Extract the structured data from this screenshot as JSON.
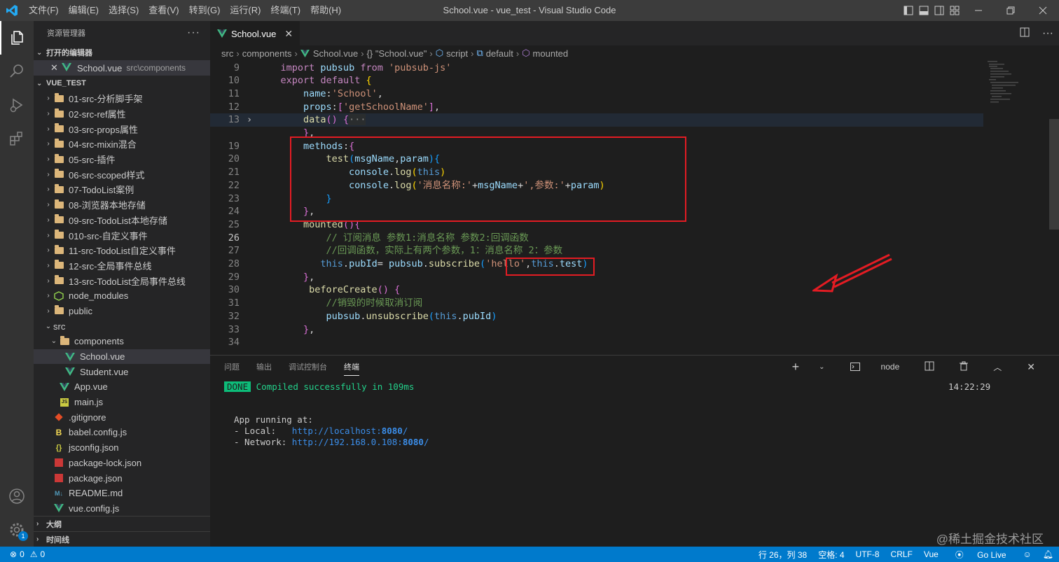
{
  "titlebar": {
    "menu": [
      "文件(F)",
      "编辑(E)",
      "选择(S)",
      "查看(V)",
      "转到(G)",
      "运行(R)",
      "终端(T)",
      "帮助(H)"
    ],
    "window_title": "School.vue - vue_test - Visual Studio Code"
  },
  "sidebar": {
    "header": "资源管理器",
    "open_editors_label": "打开的编辑器",
    "open_editor": {
      "name": "School.vue",
      "path": "src\\components"
    },
    "project_label": "VUE_TEST",
    "tree": [
      {
        "label": "01-src-分析脚手架",
        "type": "folder",
        "depth": 1
      },
      {
        "label": "02-src-ref属性",
        "type": "folder",
        "depth": 1
      },
      {
        "label": "03-src-props属性",
        "type": "folder",
        "depth": 1
      },
      {
        "label": "04-src-mixin混合",
        "type": "folder",
        "depth": 1
      },
      {
        "label": "05-src-插件",
        "type": "folder",
        "depth": 1
      },
      {
        "label": "06-src-scoped样式",
        "type": "folder",
        "depth": 1
      },
      {
        "label": "07-TodoList案例",
        "type": "folder",
        "depth": 1
      },
      {
        "label": "08-浏览器本地存储",
        "type": "folder",
        "depth": 1
      },
      {
        "label": "09-src-TodoList本地存储",
        "type": "folder",
        "depth": 1
      },
      {
        "label": "010-src-自定义事件",
        "type": "folder",
        "depth": 1
      },
      {
        "label": "11-src-TodoList自定义事件",
        "type": "folder",
        "depth": 1
      },
      {
        "label": "12-src-全局事件总线",
        "type": "folder",
        "depth": 1
      },
      {
        "label": "13-src-TodoList全局事件总线",
        "type": "folder",
        "depth": 1
      },
      {
        "label": "node_modules",
        "type": "node",
        "depth": 1
      },
      {
        "label": "public",
        "type": "folder",
        "depth": 1
      },
      {
        "label": "src",
        "type": "open",
        "depth": 1
      },
      {
        "label": "components",
        "type": "openfolder",
        "depth": 2
      },
      {
        "label": "School.vue",
        "type": "vue",
        "depth": 3,
        "selected": true
      },
      {
        "label": "Student.vue",
        "type": "vue",
        "depth": 3
      },
      {
        "label": "App.vue",
        "type": "vue",
        "depth": 2
      },
      {
        "label": "main.js",
        "type": "js",
        "depth": 2
      },
      {
        "label": ".gitignore",
        "type": "git",
        "depth": 1
      },
      {
        "label": "babel.config.js",
        "type": "babel",
        "depth": 1
      },
      {
        "label": "jsconfig.json",
        "type": "json",
        "depth": 1
      },
      {
        "label": "package-lock.json",
        "type": "npm",
        "depth": 1
      },
      {
        "label": "package.json",
        "type": "npm",
        "depth": 1
      },
      {
        "label": "README.md",
        "type": "md",
        "depth": 1
      },
      {
        "label": "vue.config.js",
        "type": "vue",
        "depth": 1
      }
    ],
    "outline_label": "大纲",
    "timeline_label": "时间线"
  },
  "activity": {
    "settings_badge": "1"
  },
  "editor": {
    "tab": "School.vue",
    "breadcrumbs": [
      "src",
      "components",
      "School.vue",
      "{} \"School.vue\"",
      "script",
      "default",
      "mounted"
    ],
    "lines": [
      {
        "n": "9",
        "tokens": [
          [
            "    ",
            "pn"
          ],
          [
            "import",
            "kw2"
          ],
          [
            " pubsub ",
            "id"
          ],
          [
            "from",
            "kw2"
          ],
          [
            " ",
            "pn"
          ],
          [
            "'pubsub-js'",
            "str"
          ]
        ]
      },
      {
        "n": "10",
        "tokens": [
          [
            "    ",
            "pn"
          ],
          [
            "export",
            "kw2"
          ],
          [
            " ",
            "pn"
          ],
          [
            "default",
            "kw2"
          ],
          [
            " ",
            "pn"
          ],
          [
            "{",
            "br0"
          ]
        ]
      },
      {
        "n": "11",
        "tokens": [
          [
            "        ",
            "pn"
          ],
          [
            "name",
            "id"
          ],
          [
            ":",
            "pn"
          ],
          [
            "'School'",
            "str"
          ],
          [
            ",",
            "pn"
          ]
        ]
      },
      {
        "n": "12",
        "tokens": [
          [
            "        ",
            "pn"
          ],
          [
            "props",
            "id"
          ],
          [
            ":",
            "pn"
          ],
          [
            "[",
            "br1"
          ],
          [
            "'getSchoolName'",
            "str"
          ],
          [
            "]",
            "br1"
          ],
          [
            ",",
            "pn"
          ]
        ]
      },
      {
        "n": "13",
        "fold": true,
        "hl": true,
        "tokens": [
          [
            "        ",
            "pn"
          ],
          [
            "data",
            "fn"
          ],
          [
            "()",
            "br1"
          ],
          [
            " ",
            "pn"
          ],
          [
            "{",
            "br1"
          ],
          [
            "···",
            "ell"
          ]
        ]
      },
      {
        "n": "",
        "tokens": [
          [
            "        ",
            "pn"
          ],
          [
            "}",
            "br1"
          ],
          [
            ",",
            "pn"
          ]
        ]
      },
      {
        "n": "19",
        "tokens": [
          [
            "        ",
            "pn"
          ],
          [
            "methods",
            "id"
          ],
          [
            ":",
            "pn"
          ],
          [
            "{",
            "br1"
          ]
        ]
      },
      {
        "n": "20",
        "tokens": [
          [
            "            ",
            "pn"
          ],
          [
            "test",
            "fn"
          ],
          [
            "(",
            "br2"
          ],
          [
            "msgName",
            "id"
          ],
          [
            ",",
            "pn"
          ],
          [
            "param",
            "id"
          ],
          [
            ")",
            "br2"
          ],
          [
            "{",
            "br2"
          ]
        ]
      },
      {
        "n": "21",
        "tokens": [
          [
            "                ",
            "pn"
          ],
          [
            "console",
            "id"
          ],
          [
            ".",
            "pn"
          ],
          [
            "log",
            "fn"
          ],
          [
            "(",
            "br0"
          ],
          [
            "this",
            "kw"
          ],
          [
            ")",
            "br0"
          ]
        ]
      },
      {
        "n": "22",
        "tokens": [
          [
            "                ",
            "pn"
          ],
          [
            "console",
            "id"
          ],
          [
            ".",
            "pn"
          ],
          [
            "log",
            "fn"
          ],
          [
            "(",
            "br0"
          ],
          [
            "'消息名称:'",
            "str"
          ],
          [
            "+",
            "pn"
          ],
          [
            "msgName",
            "id"
          ],
          [
            "+",
            "pn"
          ],
          [
            "',参数:'",
            "str"
          ],
          [
            "+",
            "pn"
          ],
          [
            "param",
            "id"
          ],
          [
            ")",
            "br0"
          ]
        ]
      },
      {
        "n": "23",
        "tokens": [
          [
            "            ",
            "pn"
          ],
          [
            "}",
            "br2"
          ]
        ]
      },
      {
        "n": "24",
        "tokens": [
          [
            "        ",
            "pn"
          ],
          [
            "}",
            "br1"
          ],
          [
            ",",
            "pn"
          ]
        ]
      },
      {
        "n": "25",
        "tokens": [
          [
            "        ",
            "pn"
          ],
          [
            "mounted",
            "fn"
          ],
          [
            "()",
            "br1"
          ],
          [
            "{",
            "br1"
          ]
        ]
      },
      {
        "n": "26",
        "cur": true,
        "tokens": [
          [
            "            ",
            "pn"
          ],
          [
            "// 订阅消息 参数1:消息名称 参数2:回调函数",
            "cm"
          ]
        ]
      },
      {
        "n": "27",
        "tokens": [
          [
            "            ",
            "pn"
          ],
          [
            "//回调函数，实际上有两个参数，1：消息名称 2：参数",
            "cm"
          ]
        ]
      },
      {
        "n": "28",
        "tokens": [
          [
            "           ",
            "pn"
          ],
          [
            "this",
            "kw"
          ],
          [
            ".",
            "pn"
          ],
          [
            "pubId",
            "id"
          ],
          [
            "= ",
            "pn"
          ],
          [
            "pubsub",
            "id"
          ],
          [
            ".",
            "pn"
          ],
          [
            "subscribe",
            "fn"
          ],
          [
            "(",
            "br2"
          ],
          [
            "'hello'",
            "str"
          ],
          [
            ",",
            "pn"
          ],
          [
            "this",
            "kw"
          ],
          [
            ".",
            "pn"
          ],
          [
            "test",
            "id"
          ],
          [
            ")",
            "br2"
          ]
        ]
      },
      {
        "n": "29",
        "tokens": [
          [
            "        ",
            "pn"
          ],
          [
            "}",
            "br1"
          ],
          [
            ",",
            "pn"
          ]
        ]
      },
      {
        "n": "30",
        "tokens": [
          [
            "         ",
            "pn"
          ],
          [
            "beforeCreate",
            "fn"
          ],
          [
            "()",
            "br1"
          ],
          [
            " ",
            "pn"
          ],
          [
            "{",
            "br1"
          ]
        ]
      },
      {
        "n": "31",
        "tokens": [
          [
            "            ",
            "pn"
          ],
          [
            "//销毁的时候取消订阅",
            "cm"
          ]
        ]
      },
      {
        "n": "32",
        "tokens": [
          [
            "            ",
            "pn"
          ],
          [
            "pubsub",
            "id"
          ],
          [
            ".",
            "pn"
          ],
          [
            "unsubscribe",
            "fn"
          ],
          [
            "(",
            "br2"
          ],
          [
            "this",
            "kw"
          ],
          [
            ".",
            "pn"
          ],
          [
            "pubId",
            "id"
          ],
          [
            ")",
            "br2"
          ]
        ]
      },
      {
        "n": "33",
        "tokens": [
          [
            "        ",
            "pn"
          ],
          [
            "}",
            "br1"
          ],
          [
            ",",
            "pn"
          ]
        ]
      },
      {
        "n": "34",
        "tokens": []
      }
    ]
  },
  "panel": {
    "tabs": [
      "问题",
      "输出",
      "调试控制台",
      "终端"
    ],
    "active_tab": "终端",
    "terminal_name": "node",
    "done_label": "DONE",
    "compiled_msg": "Compiled successfully in 109ms",
    "time": "14:22:29",
    "app_running": "App running at:",
    "local_label": "- Local:   ",
    "local_url": "http://localhost:",
    "local_port": "8080",
    "local_slash": "/",
    "network_label": "- Network: ",
    "network_url": "http://192.168.0.108:",
    "network_port": "8080",
    "network_slash": "/"
  },
  "status": {
    "errors": "0",
    "warnings": "0",
    "position": "行 26，列 38",
    "spaces": "空格: 4",
    "encoding": "UTF-8",
    "eol": "CRLF",
    "language": "Vue",
    "golive": "Go Live"
  },
  "watermark": "@稀土掘金技术社区",
  "colors": {
    "accent": "#007acc",
    "annotation": "#e31c23",
    "vue": "#41b883"
  }
}
